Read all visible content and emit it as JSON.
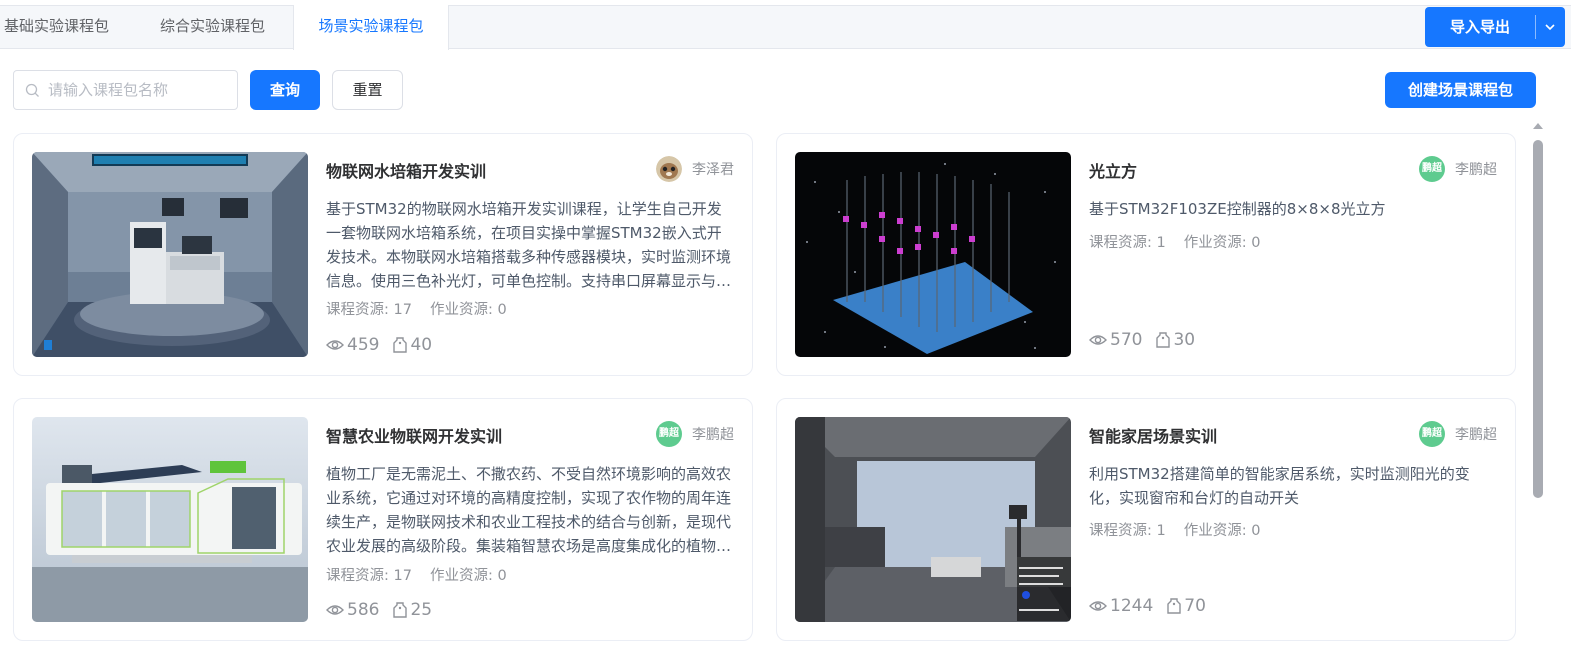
{
  "tabs": [
    {
      "label": "基础实验课程包"
    },
    {
      "label": "综合实验课程包"
    },
    {
      "label": "场景实验课程包"
    }
  ],
  "active_tab": "场景实验课程包",
  "header": {
    "import_export_label": "导入导出"
  },
  "toolbar": {
    "search_placeholder": "请输入课程包名称",
    "search_value": "",
    "query_label": "查询",
    "reset_label": "重置",
    "create_label": "创建场景课程包"
  },
  "cards": [
    {
      "title": "物联网水培箱开发实训",
      "author": "李泽君",
      "description": "基于STM32的物联网水培箱开发实训课程，让学生自己开发一套物联网水培箱系统，在项目实操中掌握STM32嵌入式开发技术。本物联网水培箱搭载多种传感器模块，实时监测环境信息。使用三色补光灯，可单色控制。支持串口屏幕显示与远程控制。",
      "resources_label": "课程资源: 17",
      "homework_label": "作业资源: 0",
      "views": "459",
      "favorites": "40"
    },
    {
      "title": "光立方",
      "author": "李鹏超",
      "avatar_text": "鹏超",
      "description": "基于STM32F103ZE控制器的8×8×8光立方",
      "resources_label": "课程资源: 1",
      "homework_label": "作业资源: 0",
      "views": "570",
      "favorites": "30"
    },
    {
      "title": "智慧农业物联网开发实训",
      "author": "李鹏超",
      "avatar_text": "鹏超",
      "description": "植物工厂是无需泥土、不撒农药、不受自然环境影响的高效农业系统，它通过对环境的高精度控制，实现了农作物的周年连续生产，是物联网技术和农业工程技术的结合与创新，是现代农业发展的高级阶段。集装箱智慧农场是高度集成化的植物工厂。",
      "resources_label": "课程资源: 17",
      "homework_label": "作业资源: 0",
      "views": "586",
      "favorites": "25"
    },
    {
      "title": "智能家居场景实训",
      "author": "李鹏超",
      "avatar_text": "鹏超",
      "description": "利用STM32搭建简单的智能家居系统，实时监测阳光的变化，实现窗帘和台灯的自动开关",
      "resources_label": "课程资源: 1",
      "homework_label": "作业资源: 0",
      "views": "1244",
      "favorites": "70"
    }
  ],
  "colors": {
    "primary": "#1677ff",
    "muted": "#909399",
    "avatar_green": "#5ecb8f"
  }
}
